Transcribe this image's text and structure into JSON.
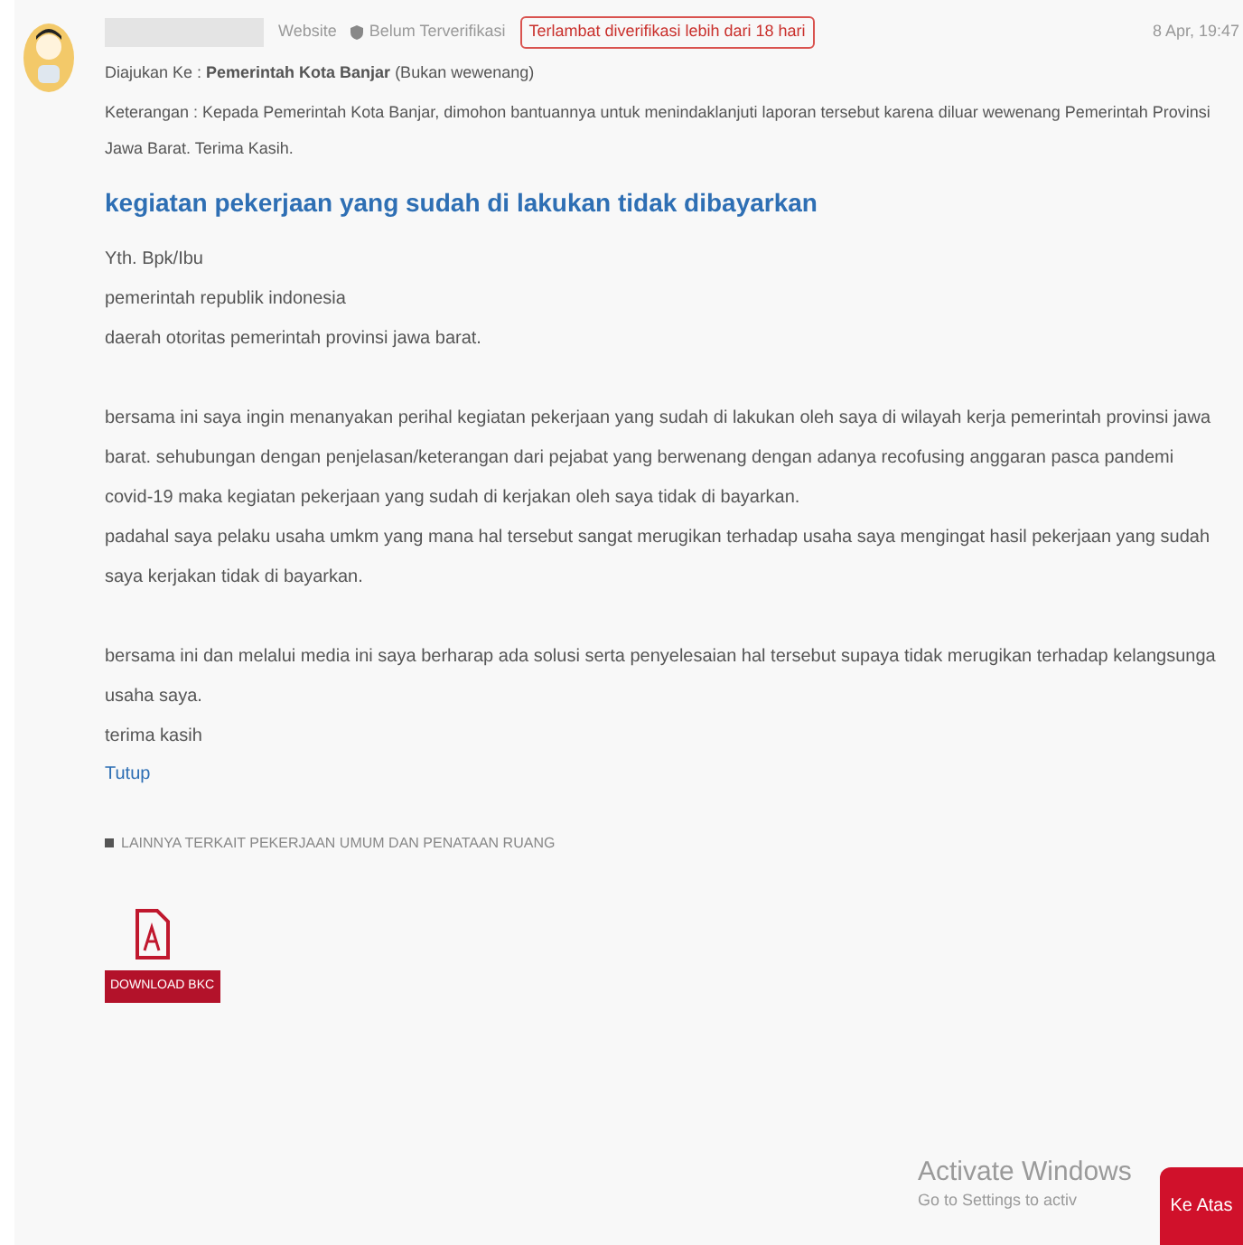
{
  "post": {
    "author_status": "Website",
    "verification": "Belum Terverifikasi",
    "late_badge": "Terlambat diverifikasi lebih dari 18 hari",
    "date": "8 Apr, 19:47",
    "submitted_to": "Diajukan Ke : **Pemerintah Kota Banjar** (Bukan wewenang)",
    "note": "Keterangan : Kepada Pemerintah Kota Banjar, dimohon bantuannya untuk menindaklanjuti laporan tersebut karena diluar wewenang Pemerintah Provinsi Jawa Barat. Terima Kasih.",
    "title": "kegiatan pekerjaan yang sudah di lakukan tidak dibayarkan",
    "body": [
      [
        "Yth. Bpk/Ibu",
        "pemerintah republik indonesia",
        "daerah otoritas pemerintah provinsi jawa barat."
      ],
      [
        "bersama ini saya ingin menanyakan perihal kegiatan pekerjaan yang sudah di lakukan oleh saya di wilayah kerja pemerintah provinsi jawa",
        "barat. sehubungan dengan penjelasan/keterangan dari pejabat yang berwenang dengan adanya recofusing anggaran pasca pandemi",
        "covid-19 maka kegiatan pekerjaan yang sudah di kerjakan oleh saya tidak di bayarkan.",
        "padahal saya pelaku usaha umkm yang mana hal tersebut sangat merugikan terhadap usaha saya mengingat hasil pekerjaan yang sudah",
        "saya kerjakan tidak di bayarkan."
      ],
      [
        "bersama ini dan melalui media ini saya berharap ada solusi serta penyelesaian hal tersebut supaya tidak merugikan terhadap kelangsunga",
        "usaha saya.",
        "terima kasih"
      ]
    ],
    "close_link": "Tutup",
    "category": "LAINNYA TERKAIT PEKERJAAN UMUM DAN PENATAAN RUANG",
    "attachment": {
      "button": "DOWNLOAD BKC"
    }
  },
  "os_notice": {
    "title": "Activate Windows",
    "text": "Go to Settings to activ"
  },
  "back_to_top": "Ke Atas"
}
